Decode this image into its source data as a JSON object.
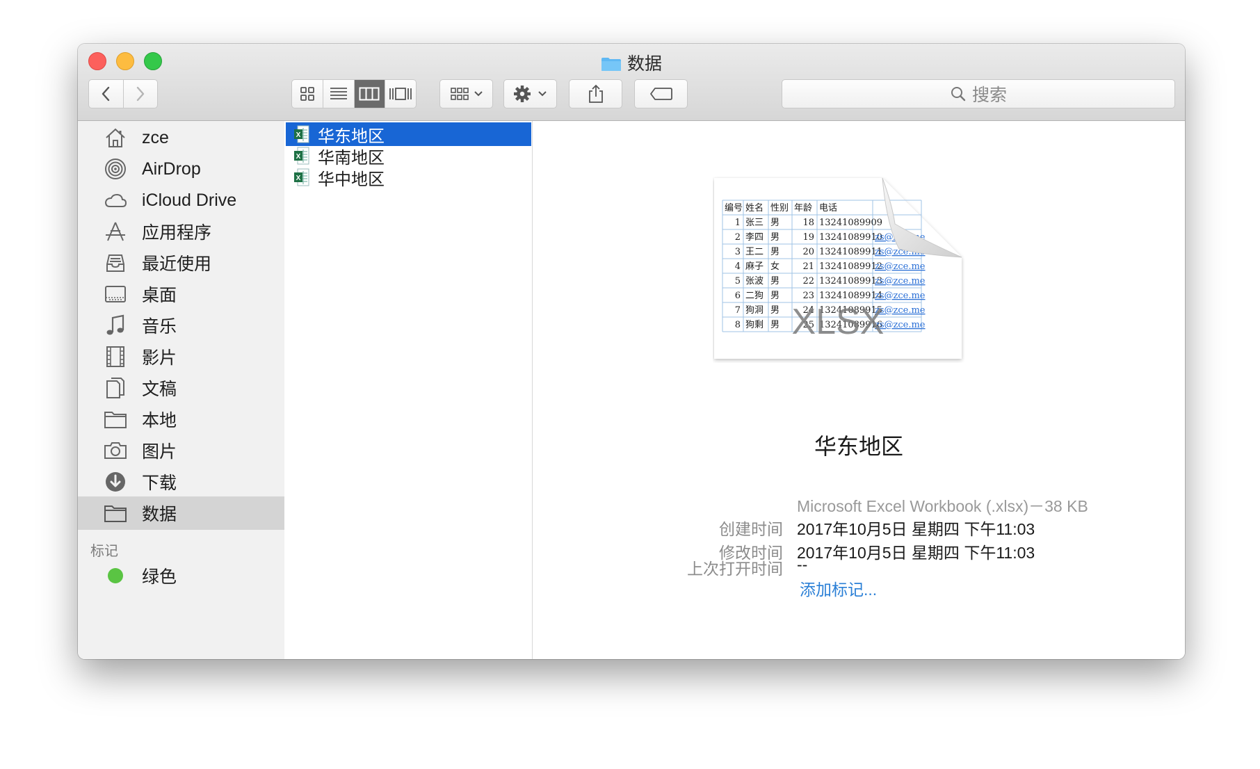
{
  "window": {
    "title": "数据",
    "search_placeholder": "搜索"
  },
  "sidebar": {
    "items": [
      {
        "label": "zce",
        "icon": "home-icon"
      },
      {
        "label": "AirDrop",
        "icon": "airdrop-icon"
      },
      {
        "label": "iCloud Drive",
        "icon": "cloud-icon"
      },
      {
        "label": "应用程序",
        "icon": "applications-icon"
      },
      {
        "label": "最近使用",
        "icon": "recents-icon"
      },
      {
        "label": "桌面",
        "icon": "desktop-icon"
      },
      {
        "label": "音乐",
        "icon": "music-icon"
      },
      {
        "label": "影片",
        "icon": "movies-icon"
      },
      {
        "label": "文稿",
        "icon": "documents-icon"
      },
      {
        "label": "本地",
        "icon": "folder-icon"
      },
      {
        "label": "图片",
        "icon": "camera-icon"
      },
      {
        "label": "下载",
        "icon": "download-icon"
      },
      {
        "label": "数据",
        "icon": "folder-icon",
        "selected": true
      }
    ],
    "tags_header": "标记",
    "tags": [
      {
        "label": "绿色",
        "color": "#5ac443"
      }
    ]
  },
  "files": [
    {
      "name": "华东地区",
      "selected": true
    },
    {
      "name": "华南地区"
    },
    {
      "name": "华中地区"
    }
  ],
  "preview": {
    "name": "华东地区",
    "kind": "Microsoft Excel Workbook (.xlsx)－38 KB",
    "created_label": "创建时间",
    "created_value": "2017年10月5日 星期四 下午11:03",
    "modified_label": "修改时间",
    "modified_value": "2017年10月5日 星期四 下午11:03",
    "opened_label": "上次打开时间",
    "opened_value": "--",
    "add_tags": "添加标记...",
    "badge": "XLSX",
    "sheet": {
      "headers": [
        "编号",
        "姓名",
        "性别",
        "年龄",
        "电话"
      ],
      "rows": [
        [
          "1",
          "张三",
          "男",
          "18",
          "13241089909",
          ""
        ],
        [
          "2",
          "李四",
          "男",
          "19",
          "13241089910",
          "zs@zce.me"
        ],
        [
          "3",
          "王二",
          "男",
          "20",
          "13241089911",
          "zs@zce.me"
        ],
        [
          "4",
          "麻子",
          "女",
          "21",
          "13241089912",
          "zs@zce.me"
        ],
        [
          "5",
          "张波",
          "男",
          "22",
          "13241089913",
          "zs@zce.me"
        ],
        [
          "6",
          "二狗",
          "男",
          "23",
          "13241089914",
          "zs@zce.me"
        ],
        [
          "7",
          "狗洞",
          "男",
          "24",
          "13241089915",
          "zs@zce.me"
        ],
        [
          "8",
          "狗剩",
          "男",
          "25",
          "13241089916",
          "zs@zce.me"
        ]
      ]
    }
  },
  "colors": {
    "selection": "#1866d5",
    "link": "#2a7fd6",
    "tag_green": "#5ac443",
    "excel_green": "#1e7145"
  }
}
